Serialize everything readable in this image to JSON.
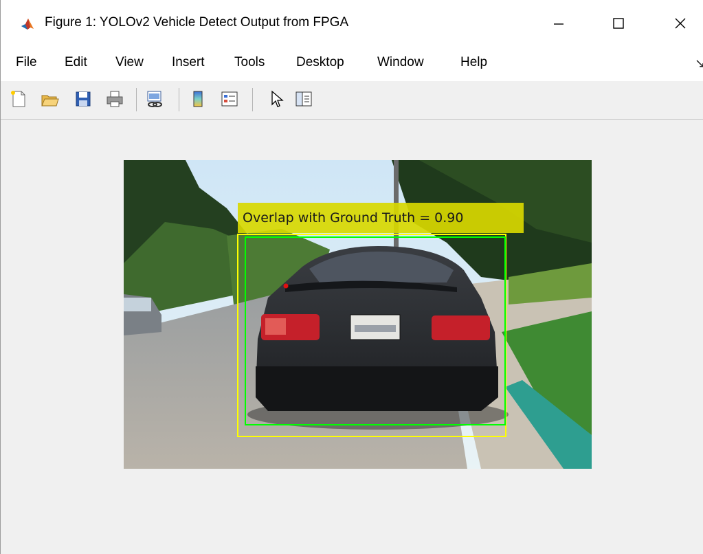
{
  "window": {
    "title": "Figure 1: YOLOv2 Vehicle Detect Output from FPGA"
  },
  "menu": {
    "items": [
      "File",
      "Edit",
      "View",
      "Insert",
      "Tools",
      "Desktop",
      "Window",
      "Help"
    ]
  },
  "toolbar": {
    "buttons": [
      "new-figure",
      "open-file",
      "save",
      "print",
      "link-plot",
      "insert-colorbar",
      "insert-legend",
      "edit-plot",
      "property-inspector"
    ]
  },
  "figure": {
    "annotation_label": "Overlap with Ground Truth = 0.90",
    "colors": {
      "detection_box": "#ffff00",
      "ground_truth_box": "#00ff00",
      "label_background": "#d8d800"
    }
  }
}
